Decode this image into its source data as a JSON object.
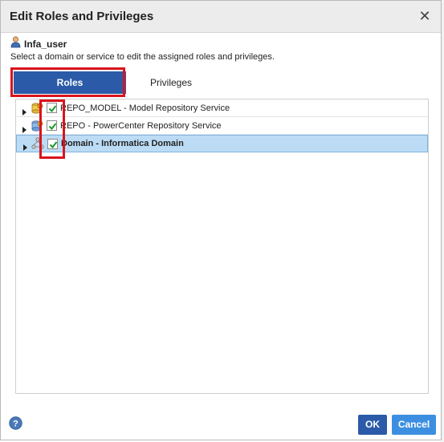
{
  "dialog": {
    "title": "Edit Roles and Privileges",
    "close_label": "✕"
  },
  "user": {
    "name": "Infa_user",
    "icon": "user-icon"
  },
  "instruction": "Select a domain or service to edit the assigned roles and privileges.",
  "tabs": [
    {
      "label": "Roles",
      "active": true
    },
    {
      "label": "Privileges",
      "active": false
    }
  ],
  "tree": {
    "rows": [
      {
        "label": "REPO_MODEL - Model Repository Service",
        "checked": true,
        "selected": false,
        "icon": "model-repository-icon"
      },
      {
        "label": "REPO - PowerCenter Repository Service",
        "checked": true,
        "selected": false,
        "icon": "powercenter-repository-icon"
      },
      {
        "label": "Domain - Informatica Domain",
        "checked": true,
        "selected": true,
        "icon": "domain-icon"
      }
    ]
  },
  "footer": {
    "ok_label": "OK",
    "cancel_label": "Cancel",
    "help_icon": "help-icon"
  },
  "colors": {
    "primary": "#2b5ba8",
    "secondary_button": "#3c8fe0",
    "highlight": "#d9141c",
    "selected_row": "#bcdcf5"
  }
}
